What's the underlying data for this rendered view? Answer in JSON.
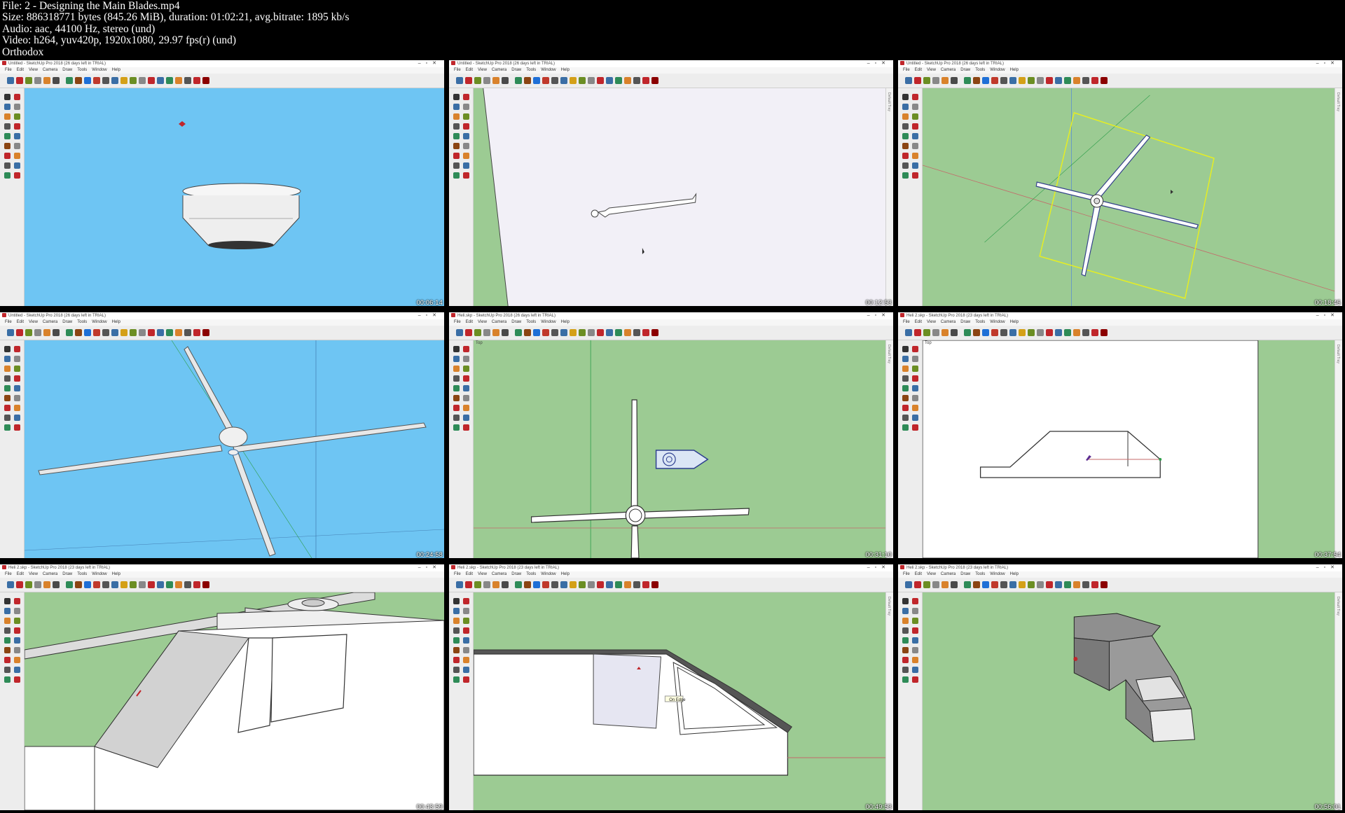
{
  "header": {
    "file": "File: 2 - Designing the Main Blades.mp4",
    "size": "Size: 886318771 bytes (845.26 MiB), duration: 01:02:21, avg.bitrate: 1895 kb/s",
    "audio": "Audio: aac, 44100 Hz, stereo (und)",
    "video": "Video: h264, yuv420p, 1920x1080, 29.97 fps(r) (und)",
    "author": "Orthodox"
  },
  "menu": [
    "File",
    "Edit",
    "View",
    "Camera",
    "Draw",
    "Tools",
    "Window",
    "Help"
  ],
  "tray_label": "Default Tray",
  "view_label_top": "Top",
  "tooltip_edge": "On Edge",
  "colors": {
    "sky": "#6ec5f3",
    "ground": "#9ccb93",
    "paper": "#f2f0f7",
    "white": "#ffffff",
    "select": "#e6ee22",
    "accent": "#c0262b"
  },
  "panels": [
    {
      "title": "Untitled - SketchUp Pro 2018 (26 days left in TRIAL)",
      "timestamp": "00:06:14"
    },
    {
      "title": "Untitled - SketchUp Pro 2018 (26 days left in TRIAL)",
      "timestamp": "00:12:53"
    },
    {
      "title": "Untitled - SketchUp Pro 2018 (26 days left in TRIAL)",
      "timestamp": "00:18:45"
    },
    {
      "title": "Untitled - SketchUp Pro 2018 (26 days left in TRIAL)",
      "timestamp": "00:24:58"
    },
    {
      "title": "Heli.skp - SketchUp Pro 2018 (26 days left in TRIAL)",
      "timestamp": "00:31:10"
    },
    {
      "title": "Heli 2.skp - SketchUp Pro 2018 (23 days left in TRIAL)",
      "timestamp": "00:37:54"
    },
    {
      "title": "Heli 2.skp - SketchUp Pro 2018 (23 days left in TRIAL)",
      "timestamp": "00:43:59"
    },
    {
      "title": "Heli 2.skp - SketchUp Pro 2018 (23 days left in TRIAL)",
      "timestamp": "00:49:53"
    },
    {
      "title": "Heli 2.skp - SketchUp Pro 2018 (23 days left in TRIAL)",
      "timestamp": "00:56:01"
    }
  ]
}
